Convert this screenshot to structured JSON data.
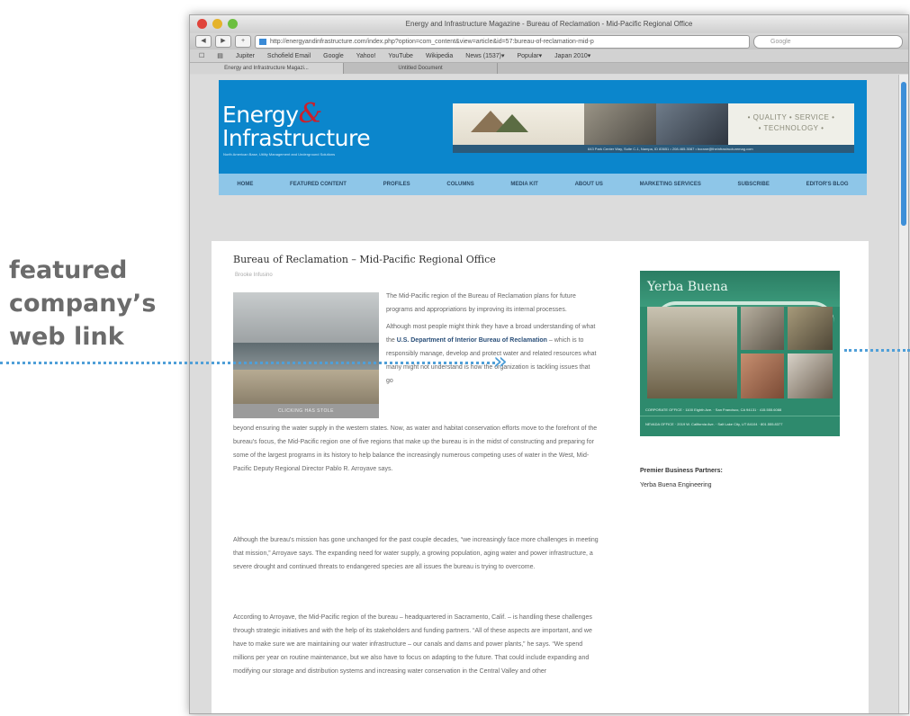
{
  "annotation": {
    "lines": [
      "featured",
      "company’s",
      "web link"
    ],
    "arrow": "»",
    "color": "#4f9fd8"
  },
  "browser": {
    "window_title": "Energy and Infrastructure Magazine - Bureau of Reclamation - Mid-Pacific Regional Office",
    "url": "http://energyandinfrastructure.com/index.php?option=com_content&view=article&id=57:bureau-of-reclamation-mid-p",
    "search_placeholder": "Google",
    "bookmarks": [
      "Jupiter",
      "Schofield Email",
      "Google",
      "Yahoo!",
      "YouTube",
      "Wikipedia",
      "News (1537)▾",
      "Popular▾",
      "Japan 2010▾"
    ],
    "tabs": [
      "Energy and Infrastructure Magazi...",
      "Untitled Document"
    ]
  },
  "site": {
    "logo_line1": "Energy",
    "logo_amp": "&",
    "logo_line2": "Infrastructure",
    "tagline": "North American Base, Utility Management and Underground Solutions",
    "banner_quality": "• QUALITY • SERVICE •",
    "banner_technology": "• TECHNOLOGY •",
    "banner_address": "643 Park Center Way, Suite C-1, Nampa, ID 83651 • 208.465.3087 • bcrane@theinfrastructuremag.com",
    "brand_color": "#0b86cc",
    "nav": [
      "HOME",
      "FEATURED CONTENT",
      "PROFILES",
      "COLUMNS",
      "MEDIA KIT",
      "ABOUT US",
      "MARKETING SERVICES",
      "SUBSCRIBE",
      "EDITOR'S BLOG"
    ]
  },
  "article": {
    "title": "Bureau of Reclamation – Mid-Pacific Regional Office",
    "byline": "Brooke Infusino",
    "photo_caption": "CLICKING HAS STOLE",
    "p1": "The Mid-Pacific region of the Bureau of Reclamation plans for future programs and appropriations by improving its internal processes.",
    "p2_pre": "Although most people might think they have a broad understanding of what the",
    "p2_link": "U.S. Department of Interior Bureau of Reclamation",
    "p2_post": "– which is to responsibly manage, develop and protect water and related resources what many might not understand is how the organization is tackling issues that go",
    "p2_cont": "beyond ensuring the water supply in the western states. Now, as water and habitat conservation efforts move to the forefront of the bureau's focus, the Mid-Pacific region one of five regions that make up the bureau is in the midst of constructing and preparing for some of the largest programs in its history to help balance the increasingly numerous competing uses of water in the West, Mid-Pacific Deputy Regional Director Pablo R. Arroyave says.",
    "p3": "Although the bureau's mission has gone unchanged for the past couple decades, “we increasingly face more challenges in meeting that mission,” Arroyave says. The expanding need for water supply, a growing population, aging water and power infrastructure, a severe drought and continued threats to endangered species are all issues the bureau is trying to overcome.",
    "p4": "According to Arroyave, the Mid-Pacific region of the bureau – headquartered in Sacramento, Calif. – is handling these challenges through strategic initiatives and with the help of its stakeholders and funding partners. “All of these aspects are important, and we have to make sure we are maintaining our water infrastructure – our canals and dams and power plants,” he says. “We spend millions per year on routine maintenance, but we also have to focus on adapting to the future. That could include expanding and modifying our storage and distribution systems and increasing water conservation in the Central Valley and other"
  },
  "sidebar": {
    "ad_logo": "Yerba Buena",
    "ad_footer1": "CORPORATE OFFICE · 1100 Eighth Ave. · San Francisco, CA 94131 · 415.555.6088",
    "ad_footer2": "NEVADA OFFICE · 2019 W. California Ave. · Salt Lake City, UT 84104 · 801.555.8377",
    "ad_color": "#2e8a6d",
    "partners_heading": "Premier Business Partners:",
    "partners_value": "Yerba Buena Engineering"
  }
}
